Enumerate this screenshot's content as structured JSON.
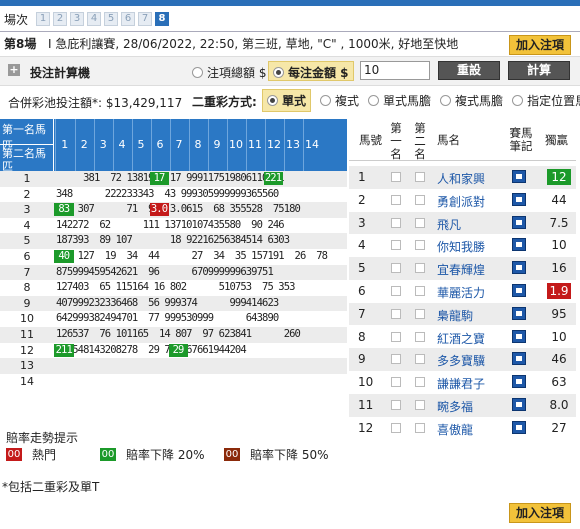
{
  "scenes": {
    "label": "場次",
    "items": [
      "1",
      "2",
      "3",
      "4",
      "5",
      "6",
      "7",
      "8"
    ],
    "active": "8"
  },
  "race": {
    "number": "第8場",
    "info": "I 急庇利讓賽, 28/06/2022, 22:50, 第三班, 草地, \"C\" , 1000米, 好地至快地"
  },
  "buttons": {
    "add_slip": "加入注項",
    "reset": "重設",
    "calc": "計算"
  },
  "calc": {
    "title": "投注計算機",
    "opt_total": "注項總額 $",
    "opt_unit": "每注金額 $",
    "amount": "10"
  },
  "pool": {
    "label": "合併彩池投注額*: $13,429,117"
  },
  "dual": {
    "title": "二重彩方式:",
    "options": [
      "單式",
      "複式",
      "單式馬膽",
      "複式馬膽",
      "指定位置馬膽"
    ],
    "selected": "單式"
  },
  "matrix": {
    "corner_top": "第一名馬匹",
    "corner_bottom": "第二名馬匹",
    "cols": [
      "1",
      "2",
      "3",
      "4",
      "5",
      "6",
      "7",
      "8",
      "9",
      "10",
      "11",
      "12",
      "13",
      "14"
    ],
    "rows": [
      {
        "label": "1",
        "text": "     381  72 138192  17 999117519806110221",
        "hl": [
          {
            "col": 6,
            "text": "17",
            "color": "green"
          },
          {
            "col": 12,
            "text": "221",
            "color": "green"
          }
        ]
      },
      {
        "label": "2",
        "text": "348      222233343  43 999305999999365560",
        "hl": []
      },
      {
        "label": "3",
        "text": " 83 307      71  96  3.0615  68 355528  75180",
        "hl": [
          {
            "col": 1,
            "text": "83",
            "color": "green"
          },
          {
            "col": 6,
            "text": "3.0",
            "color": "red"
          }
        ]
      },
      {
        "label": "4",
        "text": "142272  62      111 13710107435580  90 246",
        "hl": []
      },
      {
        "label": "5",
        "text": "187393  89 107       18 92216256384514 6303",
        "hl": []
      },
      {
        "label": "6",
        "text": " 40 127  19  34  44      27  34  35 157191  26  78",
        "hl": [
          {
            "col": 1,
            "text": "40",
            "color": "green"
          }
        ]
      },
      {
        "label": "7",
        "text": "875999459542621  96      670999999639751",
        "hl": []
      },
      {
        "label": "8",
        "text": "127403  65 115164 16 802      510753  75 353",
        "hl": []
      },
      {
        "label": "9",
        "text": "407999232336468  56 999374      999414623",
        "hl": []
      },
      {
        "label": "10",
        "text": "642999382494701  77 999530999      643890",
        "hl": []
      },
      {
        "label": "11",
        "text": "126537  76 101165  14 807  97 623841      260",
        "hl": []
      },
      {
        "label": "12",
        "text": "211548143208278  29 779267661944204",
        "hl": [
          {
            "col": 1,
            "text": "211",
            "color": "green"
          },
          {
            "col": 7,
            "text": "29",
            "color": "green"
          }
        ]
      },
      {
        "label": "13",
        "text": "",
        "hl": []
      },
      {
        "label": "14",
        "text": "",
        "hl": []
      }
    ]
  },
  "legend": {
    "title": "賠率走勢提示",
    "hot": "熱門",
    "down20": "賠率下降 20%",
    "down50": "賠率下降 50%",
    "sw_text": "00"
  },
  "footnote": "*包括二重彩及單T",
  "horses": {
    "headers": {
      "no": "馬號",
      "first": "第一名",
      "second": "第二名",
      "name": "馬名",
      "notes": "賽馬筆記",
      "win": "獨贏"
    },
    "rows": [
      {
        "no": "1",
        "name": "人和家興",
        "win": "12",
        "hl": "g"
      },
      {
        "no": "2",
        "name": "勇創派對",
        "win": "44",
        "hl": ""
      },
      {
        "no": "3",
        "name": "飛凡",
        "win": "7.5",
        "hl": ""
      },
      {
        "no": "4",
        "name": "你知我勝",
        "win": "10",
        "hl": ""
      },
      {
        "no": "5",
        "name": "宜春輝煌",
        "win": "16",
        "hl": ""
      },
      {
        "no": "6",
        "name": "華麗活力",
        "win": "1.9",
        "hl": "r"
      },
      {
        "no": "7",
        "name": "梟龍駒",
        "win": "95",
        "hl": ""
      },
      {
        "no": "8",
        "name": "紅酒之寶",
        "win": "10",
        "hl": ""
      },
      {
        "no": "9",
        "name": "多多寶驥",
        "win": "46",
        "hl": ""
      },
      {
        "no": "10",
        "name": "謙謙君子",
        "win": "63",
        "hl": ""
      },
      {
        "no": "11",
        "name": "畹多福",
        "win": "8.0",
        "hl": ""
      },
      {
        "no": "12",
        "name": "喜傲龍",
        "win": "27",
        "hl": ""
      }
    ]
  },
  "colors": {
    "header_blue": "#2b78c5",
    "hot_red": "#c41a1a",
    "green": "#1c9a2a",
    "brown": "#8b2a0a",
    "gold": "#f2c23a"
  }
}
